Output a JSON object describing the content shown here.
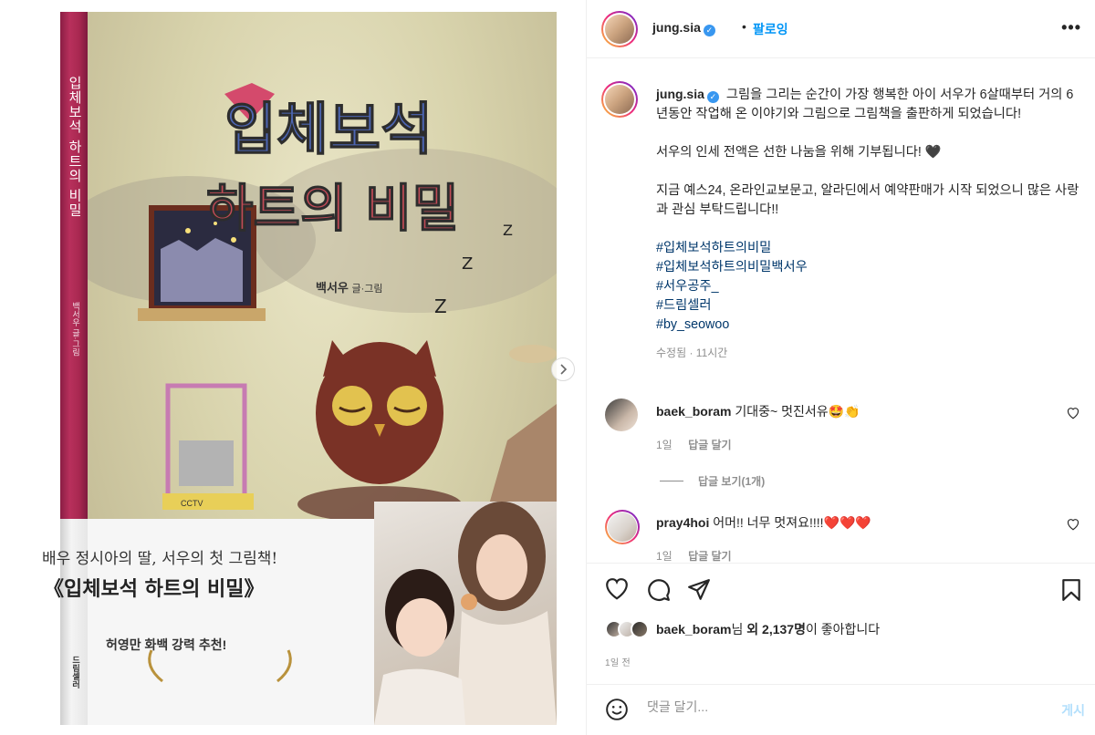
{
  "book": {
    "spine_title": "입체보석 하트의 비밀",
    "spine_author": "백서우 글·그림",
    "spine_publisher": "드림셀러",
    "cover_title_line1": "입체보석",
    "cover_title_line2": "하트의 비밀",
    "author": "백서우",
    "author_suffix": "글·그림",
    "band_line1": "배우 정시아의 딸, 서우의 첫 그림책!",
    "band_line2": "《입체보석 하트의 비밀》",
    "recommendation": "허영만 화백 강력 추천!",
    "painting_label": "CCTV"
  },
  "header": {
    "username": "jung.sia",
    "separator": "•",
    "follow_label": "팔로잉",
    "more_label": "•••"
  },
  "caption": {
    "username": "jung.sia",
    "text_1": "그림을 그리는 순간이 가장 행복한 아이 서우가 6살때부터 거의 6년동안 작업해 온 이야기와 그림으로 그림책을 출판하게 되었습니다!",
    "text_2": "서우의 인세 전액은 선한 나눔을 위해 기부됩니다! 🖤",
    "text_3": "지금 예스24, 온라인교보문고, 알라딘에서 예약판매가 시작 되었으니 많은 사랑과 관심 부탁드립니다!!",
    "hashtags": [
      "#입체보석하트의비밀",
      "#입체보석하트의비밀백서우",
      "#서우공주_",
      "#드림셀러",
      "#by_seowoo"
    ],
    "meta": "수정됨 · 11시간"
  },
  "comments": [
    {
      "username": "baek_boram",
      "text": "기대중~ 멋진서유🤩👏",
      "time": "1일",
      "reply_label": "답글 달기"
    },
    {
      "username": "pray4hoi",
      "text": "어머!! 너무 멋져요!!!!❤️❤️❤️",
      "time": "1일",
      "reply_label": "답글 달기"
    }
  ],
  "view_replies_label": "답글 보기(1개)",
  "likes": {
    "first_user": "baek_boram",
    "suffix_1": "님 ",
    "count_text": "외 2,137명",
    "suffix_2": "이 좋아합니다"
  },
  "timestamp": "1일 전",
  "add_comment": {
    "placeholder": "댓글 달기...",
    "post_label": "게시"
  },
  "colors": {
    "link": "#00376b",
    "accent": "#0095f6",
    "spine": "#a82850"
  }
}
